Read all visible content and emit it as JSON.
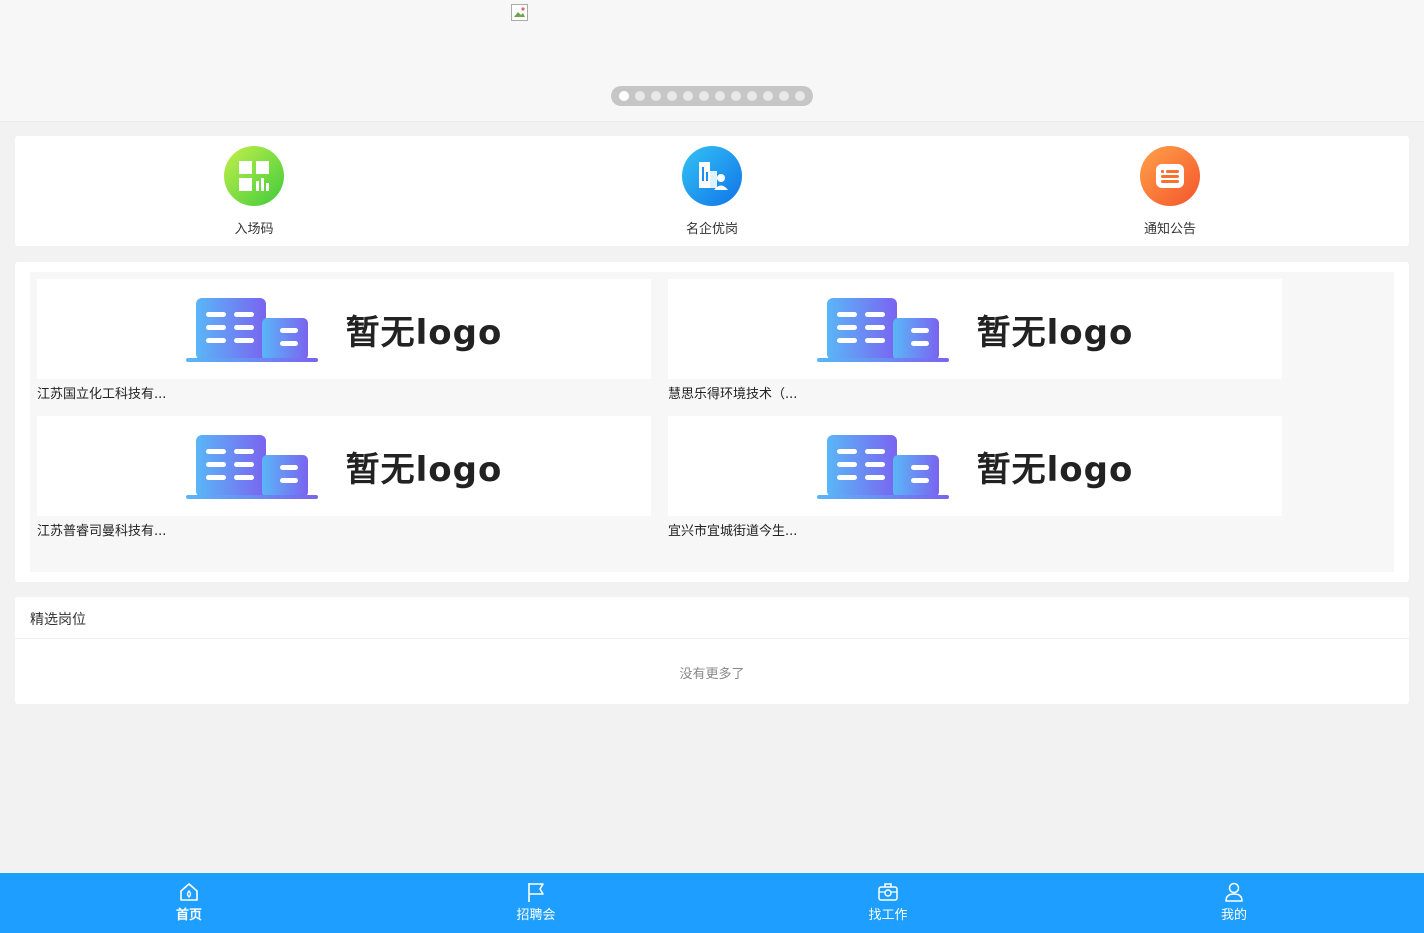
{
  "banner": {
    "slide_count": 12,
    "active_slide": 1
  },
  "quick_nav": [
    {
      "label": "入场码",
      "icon": "qr-grid-icon",
      "color": "#5cd63d"
    },
    {
      "label": "名企优岗",
      "icon": "building-person-icon",
      "color": "#1e8ff0"
    },
    {
      "label": "通知公告",
      "icon": "notice-list-icon",
      "color": "#f7712f"
    }
  ],
  "companies": [
    {
      "logo_text": "暂无logo",
      "name": "江苏国立化工科技有..."
    },
    {
      "logo_text": "暂无logo",
      "name": "慧思乐得环境技术（..."
    },
    {
      "logo_text": "暂无logo",
      "name": "江苏普睿司曼科技有..."
    },
    {
      "logo_text": "暂无logo",
      "name": "宜兴市宜城街道今生..."
    }
  ],
  "featured": {
    "title": "精选岗位",
    "empty_text": "没有更多了"
  },
  "tabbar": [
    {
      "label": "首页",
      "icon": "home-icon",
      "active": true
    },
    {
      "label": "招聘会",
      "icon": "flag-icon",
      "active": false
    },
    {
      "label": "找工作",
      "icon": "job-search-icon",
      "active": false
    },
    {
      "label": "我的",
      "icon": "user-icon",
      "active": false
    }
  ],
  "colors": {
    "tabbar_bg": "#1e9fff",
    "page_bg": "#f2f2f2"
  }
}
